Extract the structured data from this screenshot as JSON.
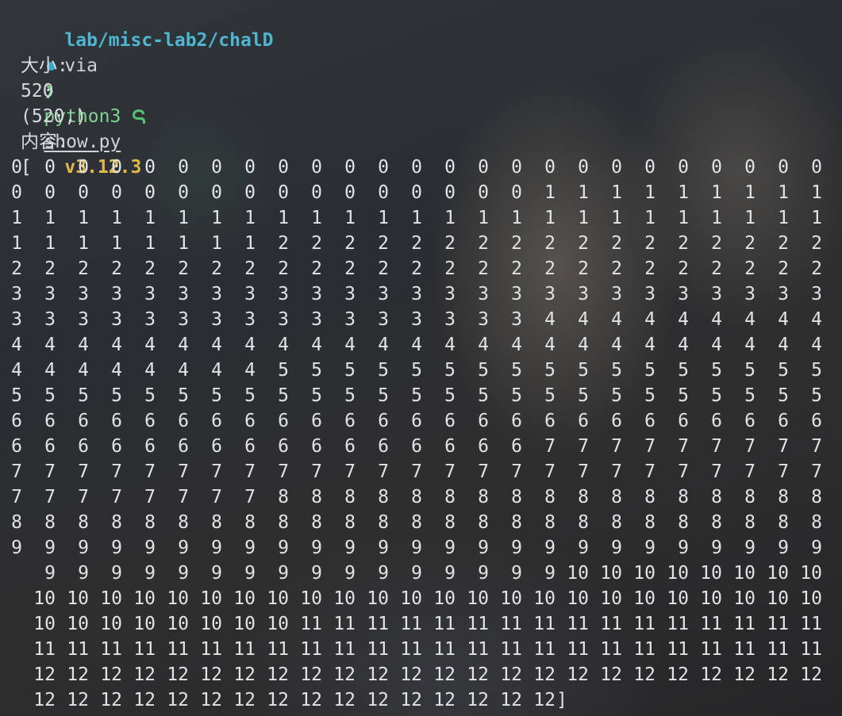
{
  "prompt_header": {
    "path": "lab/misc-lab2/chalD",
    "via": "via",
    "env_icon": "python-snake-icon",
    "python_version": "v3.12.3"
  },
  "command": {
    "prompt_symbol": "❯",
    "program": "python3",
    "script": "show.py"
  },
  "output": {
    "size_label": "大小:",
    "size_value": "520",
    "shape_value": "(520,)",
    "content_label": "内容:",
    "open_bracket": "[",
    "close_bracket": "]",
    "rows": [
      [
        "0",
        "0",
        "0",
        "0",
        "0",
        "0",
        "0",
        "0",
        "0",
        "0",
        "0",
        "0",
        "0",
        "0",
        "0",
        "0",
        "0",
        "0",
        "0",
        "0",
        "0",
        "0",
        "0",
        "0",
        "0"
      ],
      [
        "0",
        "0",
        "0",
        "0",
        "0",
        "0",
        "0",
        "0",
        "0",
        "0",
        "0",
        "0",
        "0",
        "0",
        "0",
        "0",
        "1",
        "1",
        "1",
        "1",
        "1",
        "1",
        "1",
        "1",
        "1"
      ],
      [
        "1",
        "1",
        "1",
        "1",
        "1",
        "1",
        "1",
        "1",
        "1",
        "1",
        "1",
        "1",
        "1",
        "1",
        "1",
        "1",
        "1",
        "1",
        "1",
        "1",
        "1",
        "1",
        "1",
        "1",
        "1"
      ],
      [
        "1",
        "1",
        "1",
        "1",
        "1",
        "1",
        "1",
        "1",
        "2",
        "2",
        "2",
        "2",
        "2",
        "2",
        "2",
        "2",
        "2",
        "2",
        "2",
        "2",
        "2",
        "2",
        "2",
        "2",
        "2"
      ],
      [
        "2",
        "2",
        "2",
        "2",
        "2",
        "2",
        "2",
        "2",
        "2",
        "2",
        "2",
        "2",
        "2",
        "2",
        "2",
        "2",
        "2",
        "2",
        "2",
        "2",
        "2",
        "2",
        "2",
        "2",
        "2"
      ],
      [
        "3",
        "3",
        "3",
        "3",
        "3",
        "3",
        "3",
        "3",
        "3",
        "3",
        "3",
        "3",
        "3",
        "3",
        "3",
        "3",
        "3",
        "3",
        "3",
        "3",
        "3",
        "3",
        "3",
        "3",
        "3"
      ],
      [
        "3",
        "3",
        "3",
        "3",
        "3",
        "3",
        "3",
        "3",
        "3",
        "3",
        "3",
        "3",
        "3",
        "3",
        "3",
        "3",
        "4",
        "4",
        "4",
        "4",
        "4",
        "4",
        "4",
        "4",
        "4"
      ],
      [
        "4",
        "4",
        "4",
        "4",
        "4",
        "4",
        "4",
        "4",
        "4",
        "4",
        "4",
        "4",
        "4",
        "4",
        "4",
        "4",
        "4",
        "4",
        "4",
        "4",
        "4",
        "4",
        "4",
        "4",
        "4"
      ],
      [
        "4",
        "4",
        "4",
        "4",
        "4",
        "4",
        "4",
        "4",
        "5",
        "5",
        "5",
        "5",
        "5",
        "5",
        "5",
        "5",
        "5",
        "5",
        "5",
        "5",
        "5",
        "5",
        "5",
        "5",
        "5"
      ],
      [
        "5",
        "5",
        "5",
        "5",
        "5",
        "5",
        "5",
        "5",
        "5",
        "5",
        "5",
        "5",
        "5",
        "5",
        "5",
        "5",
        "5",
        "5",
        "5",
        "5",
        "5",
        "5",
        "5",
        "5",
        "5"
      ],
      [
        "6",
        "6",
        "6",
        "6",
        "6",
        "6",
        "6",
        "6",
        "6",
        "6",
        "6",
        "6",
        "6",
        "6",
        "6",
        "6",
        "6",
        "6",
        "6",
        "6",
        "6",
        "6",
        "6",
        "6",
        "6"
      ],
      [
        "6",
        "6",
        "6",
        "6",
        "6",
        "6",
        "6",
        "6",
        "6",
        "6",
        "6",
        "6",
        "6",
        "6",
        "6",
        "6",
        "7",
        "7",
        "7",
        "7",
        "7",
        "7",
        "7",
        "7",
        "7"
      ],
      [
        "7",
        "7",
        "7",
        "7",
        "7",
        "7",
        "7",
        "7",
        "7",
        "7",
        "7",
        "7",
        "7",
        "7",
        "7",
        "7",
        "7",
        "7",
        "7",
        "7",
        "7",
        "7",
        "7",
        "7",
        "7"
      ],
      [
        "7",
        "7",
        "7",
        "7",
        "7",
        "7",
        "7",
        "7",
        "8",
        "8",
        "8",
        "8",
        "8",
        "8",
        "8",
        "8",
        "8",
        "8",
        "8",
        "8",
        "8",
        "8",
        "8",
        "8",
        "8"
      ],
      [
        "8",
        "8",
        "8",
        "8",
        "8",
        "8",
        "8",
        "8",
        "8",
        "8",
        "8",
        "8",
        "8",
        "8",
        "8",
        "8",
        "8",
        "8",
        "8",
        "8",
        "8",
        "8",
        "8",
        "8",
        "8"
      ],
      [
        "9",
        "9",
        "9",
        "9",
        "9",
        "9",
        "9",
        "9",
        "9",
        "9",
        "9",
        "9",
        "9",
        "9",
        "9",
        "9",
        "9",
        "9",
        "9",
        "9",
        "9",
        "9",
        "9",
        "9",
        "9"
      ],
      [
        "9",
        "9",
        "9",
        "9",
        "9",
        "9",
        "9",
        "9",
        "9",
        "9",
        "9",
        "9",
        "9",
        "9",
        "9",
        "9",
        "10",
        "10",
        "10",
        "10",
        "10",
        "10",
        "10",
        "10"
      ],
      [
        "10",
        "10",
        "10",
        "10",
        "10",
        "10",
        "10",
        "10",
        "10",
        "10",
        "10",
        "10",
        "10",
        "10",
        "10",
        "10",
        "10",
        "10",
        "10",
        "10",
        "10",
        "10",
        "10",
        "10"
      ],
      [
        "10",
        "10",
        "10",
        "10",
        "10",
        "10",
        "10",
        "10",
        "11",
        "11",
        "11",
        "11",
        "11",
        "11",
        "11",
        "11",
        "11",
        "11",
        "11",
        "11",
        "11",
        "11",
        "11",
        "11"
      ],
      [
        "11",
        "11",
        "11",
        "11",
        "11",
        "11",
        "11",
        "11",
        "11",
        "11",
        "11",
        "11",
        "11",
        "11",
        "11",
        "11",
        "11",
        "11",
        "11",
        "11",
        "11",
        "11",
        "11",
        "11"
      ],
      [
        "12",
        "12",
        "12",
        "12",
        "12",
        "12",
        "12",
        "12",
        "12",
        "12",
        "12",
        "12",
        "12",
        "12",
        "12",
        "12",
        "12",
        "12",
        "12",
        "12",
        "12",
        "12",
        "12",
        "12"
      ],
      [
        "12",
        "12",
        "12",
        "12",
        "12",
        "12",
        "12",
        "12",
        "12",
        "12",
        "12",
        "12",
        "12",
        "12",
        "12",
        "12"
      ]
    ]
  }
}
